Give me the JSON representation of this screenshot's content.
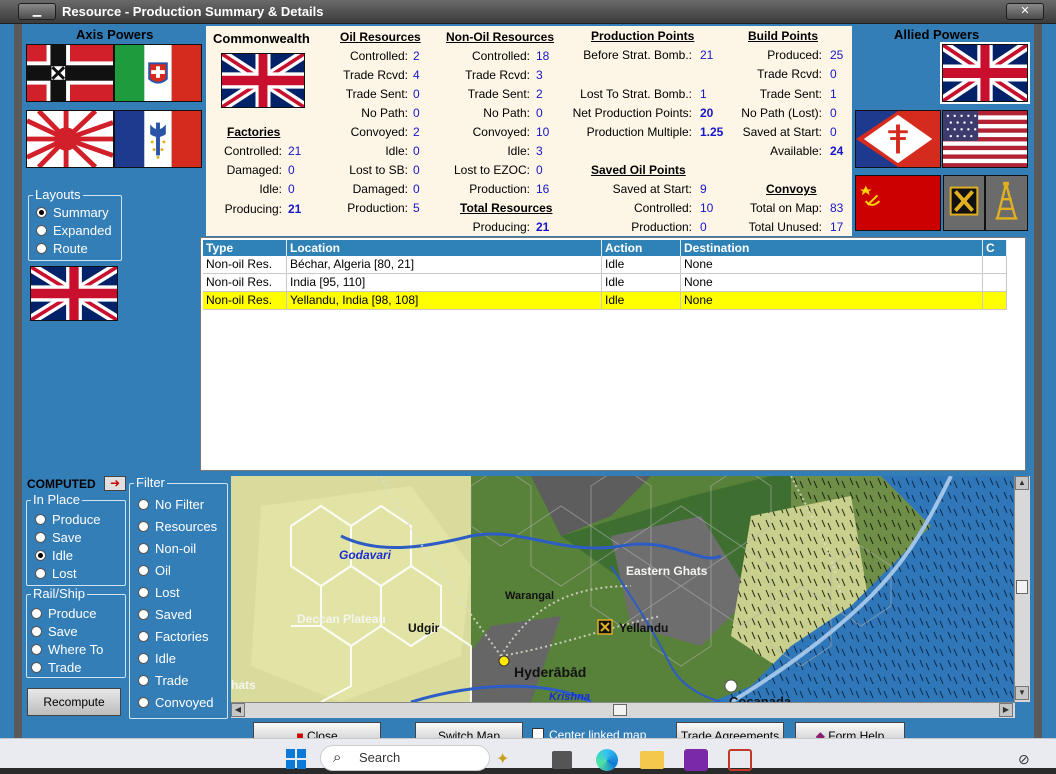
{
  "window": {
    "title": "Resource - Production Summary & Details"
  },
  "left": {
    "axis_title": "Axis Powers",
    "layouts": {
      "legend": "Layouts",
      "options": [
        "Summary",
        "Expanded",
        "Route"
      ],
      "selected": 0
    },
    "computed_label": "COMPUTED",
    "in_place": {
      "legend": "In Place",
      "options": [
        "Produce",
        "Save",
        "Idle",
        "Lost"
      ],
      "selected": 2
    },
    "rail_ship": {
      "legend": "Rail/Ship",
      "options": [
        "Produce",
        "Save",
        "Where To",
        "Trade"
      ]
    },
    "recompute_label": "Recompute"
  },
  "filter": {
    "legend": "Filter",
    "options": [
      "No Filter",
      "Resources",
      "Non-oil",
      "Oil",
      "Lost",
      "Saved",
      "Factories",
      "Idle",
      "Trade",
      "Convoyed"
    ]
  },
  "right": {
    "allied_title": "Allied Powers"
  },
  "summary": {
    "country": "Commonwealth",
    "factories": {
      "title": "Factories",
      "rows": [
        [
          "Controlled:",
          "21"
        ],
        [
          "Damaged:",
          "0"
        ],
        [
          "Idle:",
          "0"
        ],
        [
          "Producing:",
          "21"
        ]
      ]
    },
    "oil": {
      "title": "Oil Resources",
      "rows": [
        [
          "Controlled:",
          "2"
        ],
        [
          "Trade Rcvd:",
          "4"
        ],
        [
          "Trade Sent:",
          "0"
        ],
        [
          "No Path:",
          "0"
        ],
        [
          "Convoyed:",
          "2"
        ],
        [
          "Idle:",
          "0"
        ],
        [
          "Lost to SB:",
          "0"
        ],
        [
          "Damaged:",
          "0"
        ],
        [
          "Production:",
          "5"
        ]
      ]
    },
    "nonoil": {
      "title": "Non-Oil Resources",
      "rows": [
        [
          "Controlled:",
          "18"
        ],
        [
          "Trade Rcvd:",
          "3"
        ],
        [
          "Trade Sent:",
          "2"
        ],
        [
          "No Path:",
          "0"
        ],
        [
          "Convoyed:",
          "10"
        ],
        [
          "Idle:",
          "3"
        ],
        [
          "Lost to EZOC:",
          "0"
        ],
        [
          "Production:",
          "16"
        ]
      ]
    },
    "total": {
      "title": "Total Resources",
      "rows": [
        [
          "Producing:",
          "21"
        ]
      ]
    },
    "pp": {
      "title": "Production Points",
      "rows": [
        [
          "Before Strat. Bomb.:",
          "21"
        ],
        [
          "Lost To Strat. Bomb.:",
          "1"
        ],
        [
          "Net Production Points:",
          "20"
        ],
        [
          "Production Multiple:",
          "1.25"
        ]
      ]
    },
    "soil": {
      "title": "Saved Oil Points",
      "rows": [
        [
          "Saved at Start:",
          "9"
        ],
        [
          "Controlled:",
          "10"
        ],
        [
          "Production:",
          "0"
        ]
      ]
    },
    "build": {
      "title": "Build Points",
      "rows": [
        [
          "Produced:",
          "25"
        ],
        [
          "Trade Rcvd:",
          "0"
        ],
        [
          "Trade Sent:",
          "1"
        ],
        [
          "No Path (Lost):",
          "0"
        ],
        [
          "Saved at Start:",
          "0"
        ],
        [
          "Available:",
          "24"
        ]
      ]
    },
    "convoys": {
      "title": "Convoys",
      "rows": [
        [
          "Total on Map:",
          "83"
        ],
        [
          "Total Unused:",
          "17"
        ]
      ]
    }
  },
  "table": {
    "columns": [
      "Type",
      "Location",
      "Action",
      "Destination",
      "C"
    ],
    "rows": [
      [
        "Non-oil Res.",
        "Béchar, Algeria [80, 21]",
        "Idle",
        "None",
        ""
      ],
      [
        "Non-oil Res.",
        "India [95, 110]",
        "Idle",
        "None",
        ""
      ],
      [
        "Non-oil Res.",
        "Yellandu, India [98, 108]",
        "Idle",
        "None",
        ""
      ]
    ],
    "highlighted_row": 2
  },
  "map": {
    "labels": {
      "godavari": "Godavari",
      "eastern_ghats": "Eastern Ghats",
      "warangal": "Warangal",
      "deccan": "Deccan Plateau",
      "udgir": "Udgir",
      "yellandu": "Yellandu",
      "hyderabad": "Hyderābād",
      "krishna": "Krishna",
      "ghats": "hats",
      "cocanada": "Cocanada"
    }
  },
  "buttons": {
    "close": "Close",
    "switch_map": "Switch Map",
    "center_linked": "Center linked map",
    "trade_agreements": "Trade Agreements",
    "form_help": "Form Help"
  },
  "taskbar": {
    "search_placeholder": "Search"
  },
  "colors": {
    "panel_blue": "#347eb8",
    "summary_bg": "#fdf5e6",
    "value_blue": "#1616c8",
    "row_highlight": "#ffff00",
    "header_blue": "#2f82b6"
  }
}
